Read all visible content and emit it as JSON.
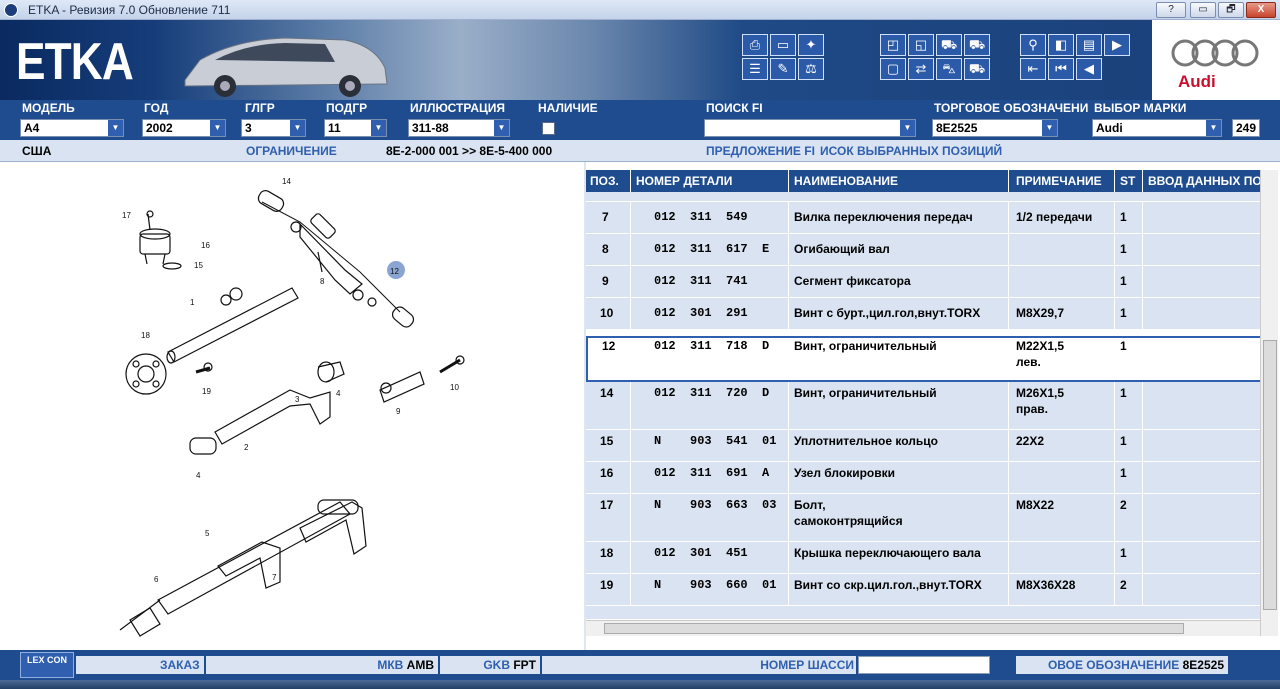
{
  "window": {
    "title": "ETKA - Ревизия 7.0 Обновление 711",
    "buttons": [
      "?",
      "▭",
      "🗗",
      "X"
    ]
  },
  "banner": {
    "logo": "ETKA",
    "brand": "Audi"
  },
  "labels": {
    "model": "МОДЕЛЬ",
    "year": "ГОД",
    "glgr": "ГЛГР",
    "podgr": "ПОДГР",
    "illustration": "ИЛЛЮСТРАЦИЯ",
    "availability": "НАЛИЧИЕ",
    "search": "ПОИСК FI",
    "trade": "ТОРГОВОЕ ОБОЗНАЧЕНИ",
    "brand_select": "ВЫБОР МАРКИ"
  },
  "fields": {
    "model": "A4",
    "year": "2002",
    "glgr": "3",
    "podgr": "11",
    "illustration": "311-88",
    "search": "",
    "trade": "8E2525",
    "brand": "Audi",
    "count": "249"
  },
  "info": {
    "region": "США",
    "restriction_label": "ОГРАНИЧЕНИЕ",
    "restriction_value": "8E-2-000 001 >> 8E-5-400 000",
    "proposal": "ПРЕДЛОЖЕНИЕ FI",
    "selected": "ИСОК ВЫБРАННЫХ ПОЗИЦИЙ"
  },
  "table": {
    "headers": [
      "ПОЗ.",
      "НОМЕР ДЕТАЛИ",
      "НАИМЕНОВАНИЕ",
      "ПРИМЕЧАНИЕ",
      "ST",
      "ВВОД ДАННЫХ ПО"
    ],
    "rows": [
      {
        "pos": "7",
        "part": "012  311  549",
        "name": "Вилка переключения передач",
        "note": "1/2 передачи",
        "st": "1"
      },
      {
        "pos": "8",
        "part": "012  311  617  E",
        "name": "Огибающий вал",
        "note": "",
        "st": "1"
      },
      {
        "pos": "9",
        "part": "012  311  741",
        "name": "Сегмент фиксатора",
        "note": "",
        "st": "1"
      },
      {
        "pos": "10",
        "part": "012  301  291",
        "name": "Винт с бурт.,цил.гол,внут.TORX",
        "note": "M8X29,7",
        "st": "1"
      },
      {
        "pos": "12",
        "part": "012  311  718  D",
        "name": "Винт, ограничительный",
        "note": "M22X1,5",
        "note2": "лев.",
        "st": "1"
      },
      {
        "pos": "14",
        "part": "012  311  720  D",
        "name": "Винт, ограничительный",
        "note": "M26X1,5",
        "note2": "прав.",
        "st": "1"
      },
      {
        "pos": "15",
        "part": "N    903  541  01",
        "name": "Уплотнительное кольцо",
        "note": "22X2",
        "st": "1"
      },
      {
        "pos": "16",
        "part": "012  311  691  A",
        "name": "Узел блокировки",
        "note": "",
        "st": "1"
      },
      {
        "pos": "17",
        "part": "N    903  663  03",
        "name": "Болт,",
        "name2": "самоконтрящийся",
        "note": "M8X22",
        "st": "2"
      },
      {
        "pos": "18",
        "part": "012  301  451",
        "name": "Крышка переключающего вала",
        "note": "",
        "st": "1"
      },
      {
        "pos": "19",
        "part": "N    903  660  01",
        "name": "Винт со скр.цил.гол.,внут.TORX",
        "note": "M8X36X28",
        "st": "2"
      }
    ]
  },
  "diagram_labels": [
    "14",
    "17",
    "16",
    "15",
    "12",
    "8",
    "1",
    "18",
    "19",
    "4",
    "10",
    "9",
    "2",
    "4",
    "3",
    "5",
    "6",
    "7"
  ],
  "bottom": {
    "lex": "LEX CON",
    "order": "ЗАКАЗ",
    "mkb_label": "МКВ",
    "mkb_value": "AMB",
    "gkb_label": "GKB",
    "gkb_value": "FPT",
    "chassis": "НОМЕР ШАССИ",
    "chassis_value": "",
    "new_label": "ОВОЕ ОБОЗНАЧЕНИЕ",
    "new_value": "8E2525"
  }
}
